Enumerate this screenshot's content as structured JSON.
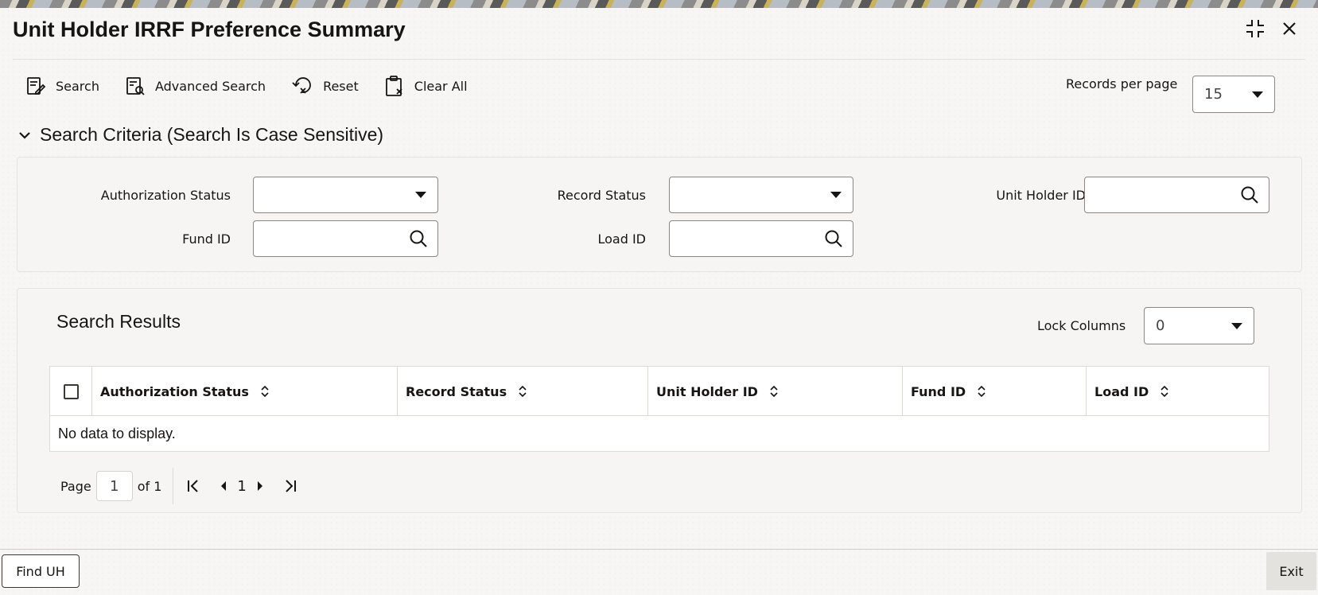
{
  "window": {
    "title": "Unit Holder IRRF Preference Summary"
  },
  "toolbar": {
    "search": "Search",
    "advanced_search": "Advanced Search",
    "reset": "Reset",
    "clear_all": "Clear All",
    "records_per_page_label": "Records per page",
    "records_per_page_value": "15"
  },
  "criteria": {
    "heading": "Search Criteria (Search Is Case Sensitive)",
    "authorization_status_label": "Authorization Status",
    "authorization_status_value": "",
    "record_status_label": "Record Status",
    "record_status_value": "",
    "unit_holder_id_label": "Unit Holder ID",
    "fund_id_label": "Fund ID",
    "load_id_label": "Load ID"
  },
  "results": {
    "title": "Search Results",
    "lock_columns_label": "Lock Columns",
    "lock_columns_value": "0",
    "columns": [
      "Authorization Status",
      "Record Status",
      "Unit Holder ID",
      "Fund ID",
      "Load ID"
    ],
    "empty_message": "No data to display."
  },
  "pager": {
    "page_label": "Page",
    "page_value": "1",
    "of_label": "of 1",
    "current": "1"
  },
  "footer": {
    "find_uh": "Find UH",
    "exit": "Exit"
  }
}
